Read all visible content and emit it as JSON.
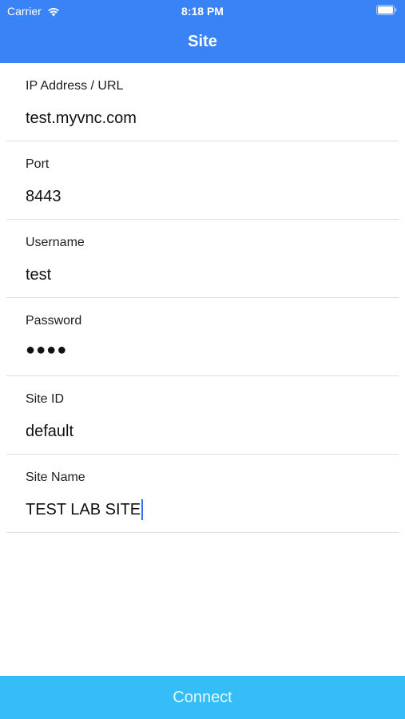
{
  "status_bar": {
    "carrier": "Carrier",
    "time": "8:18 PM"
  },
  "nav": {
    "title": "Site"
  },
  "form": {
    "fields": [
      {
        "label": "IP Address / URL",
        "value": "test.myvnc.com"
      },
      {
        "label": "Port",
        "value": "8443"
      },
      {
        "label": "Username",
        "value": "test"
      },
      {
        "label": "Password",
        "value": "●●●●"
      },
      {
        "label": "Site ID",
        "value": "default"
      },
      {
        "label": "Site Name",
        "value": "TEST LAB SITE"
      }
    ]
  },
  "connect_label": "Connect",
  "colors": {
    "header": "#3a83f7",
    "connect_button": "#35bdf7",
    "cursor": "#3a6fe8"
  },
  "icons": [
    "wifi-icon",
    "battery-icon"
  ]
}
